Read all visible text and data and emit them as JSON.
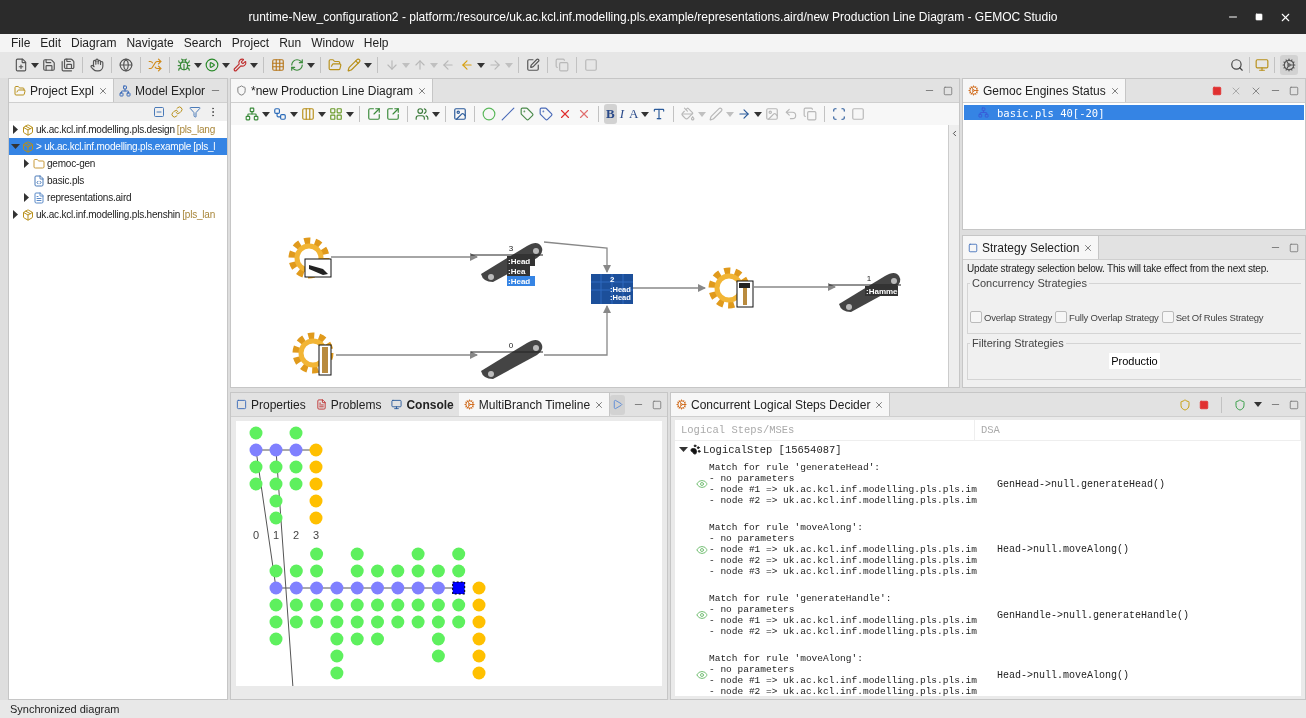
{
  "window": {
    "title": "runtime-New_configuration2 - platform:/resource/uk.ac.kcl.inf.modelling.pls.example/representations.aird/new Production Line Diagram - GEMOC Studio"
  },
  "menu": [
    "File",
    "Edit",
    "Diagram",
    "Navigate",
    "Search",
    "Project",
    "Run",
    "Window",
    "Help"
  ],
  "explorer": {
    "tabs": [
      {
        "label": "Project Expl",
        "selected": true
      },
      {
        "label": "Model Explor",
        "selected": false
      }
    ],
    "tree": [
      {
        "kind": "project",
        "label": "uk.ac.kcl.inf.modelling.pls.design",
        "decoration": "[pls_lang",
        "expanded": false,
        "selected": false
      },
      {
        "kind": "project",
        "label": "> uk.ac.kcl.inf.modelling.pls.example",
        "decoration": "[pls_l",
        "expanded": true,
        "selected": true,
        "children": [
          {
            "kind": "folder",
            "label": "gemoc-gen",
            "expanded": false,
            "selected": false
          },
          {
            "kind": "model",
            "label": "basic.pls",
            "selected": false
          },
          {
            "kind": "diagram",
            "label": "representations.aird",
            "expanded": false,
            "selected": false
          }
        ]
      },
      {
        "kind": "project",
        "label": "uk.ac.kcl.inf.modelling.pls.henshin",
        "decoration": "[pls_lan",
        "expanded": false,
        "selected": false
      }
    ]
  },
  "editor": {
    "tab": {
      "label": "*new Production Line Diagram",
      "selected": true
    },
    "format_buttons": [
      {
        "label": "B",
        "selected": true
      },
      {
        "label": "I",
        "selected": false
      },
      {
        "label": "A",
        "selected": false
      }
    ],
    "diagram": {
      "nodes": [
        {
          "kind": "generator",
          "product": {
            "kind": "head"
          }
        },
        {
          "kind": "generator",
          "product": {
            "kind": "handle"
          }
        },
        {
          "kind": "conveyor",
          "count": "3",
          "items": [
            {
              "label": ":Head",
              "selected": false
            },
            {
              "label": ":Hea",
              "selected": false
            },
            {
              "label": ":Head",
              "selected": true
            }
          ]
        },
        {
          "kind": "conveyor",
          "count": "0"
        },
        {
          "kind": "storage",
          "count": "2",
          "items": [
            {
              "label": ":Head",
              "selected": false
            },
            {
              "label": ":Head",
              "selected": false
            }
          ]
        },
        {
          "kind": "assembler",
          "product": {
            "kind": "hammer"
          }
        },
        {
          "kind": "conveyor",
          "count": "1",
          "items": [
            {
              "label": ":Hamme",
              "selected": false
            }
          ]
        }
      ]
    }
  },
  "engines": {
    "tab": {
      "label": "Gemoc Engines Status",
      "selected": true
    },
    "items": [
      {
        "label": "basic.pls 40[-20]",
        "selected": true
      }
    ]
  },
  "strategy": {
    "tab": {
      "label": "Strategy Selection",
      "selected": true
    },
    "description": "Update strategy selection below. This will take effect from the next step.",
    "concurrency": {
      "title": "Concurrency Strategies",
      "options": [
        {
          "label": "Overlap Strategy",
          "checked": false
        },
        {
          "label": "Fully Overlap Strategy",
          "checked": false
        },
        {
          "label": "Set Of Rules Strategy",
          "checked": false
        }
      ]
    },
    "filtering": {
      "title": "Filtering Strategies",
      "button": "Productio"
    }
  },
  "bottom_left": {
    "tabs": [
      {
        "label": "Properties",
        "selected": false,
        "bold": false
      },
      {
        "label": "Problems",
        "selected": false,
        "bold": false
      },
      {
        "label": "Console",
        "selected": false,
        "bold": true
      },
      {
        "label": "MultiBranch Timeline",
        "selected": true,
        "bold": false
      }
    ],
    "timeline": {
      "labels": [
        "0",
        "1",
        "2",
        "3"
      ]
    }
  },
  "decider": {
    "tab": {
      "label": "Concurrent Logical Steps Decider",
      "selected": true
    },
    "columns": [
      "Logical Steps/MSEs",
      "DSA"
    ],
    "step": {
      "label": "LogicalStep [15654087]",
      "expanded": true,
      "matches": [
        {
          "lines": [
            "Match for rule 'generateHead':",
            "- no parameters",
            "- node #1 => uk.ac.kcl.inf.modelling.pls.pls.im",
            "- node #2 => uk.ac.kcl.inf.modelling.pls.pls.im"
          ],
          "dsa": "GenHead->null.generateHead()"
        },
        {
          "lines": [
            "Match for rule 'moveAlong':",
            "- no parameters",
            "- node #1 => uk.ac.kcl.inf.modelling.pls.pls.im",
            "- node #2 => uk.ac.kcl.inf.modelling.pls.pls.im",
            "- node #3 => uk.ac.kcl.inf.modelling.pls.pls.im"
          ],
          "dsa": "Head->null.moveAlong()"
        },
        {
          "lines": [
            "Match for rule 'generateHandle':",
            "- no parameters",
            "- node #1 => uk.ac.kcl.inf.modelling.pls.pls.im",
            "- node #2 => uk.ac.kcl.inf.modelling.pls.pls.im"
          ],
          "dsa": "GenHandle->null.generateHandle()"
        },
        {
          "lines": [
            "Match for rule 'moveAlong':",
            "- no parameters",
            "- node #1 => uk.ac.kcl.inf.modelling.pls.pls.im",
            "- node #2 => uk.ac.kcl.inf.modelling.pls.pls.im"
          ],
          "dsa": "Head->null.moveAlong()"
        }
      ]
    }
  },
  "status_bar": "Synchronized diagram"
}
